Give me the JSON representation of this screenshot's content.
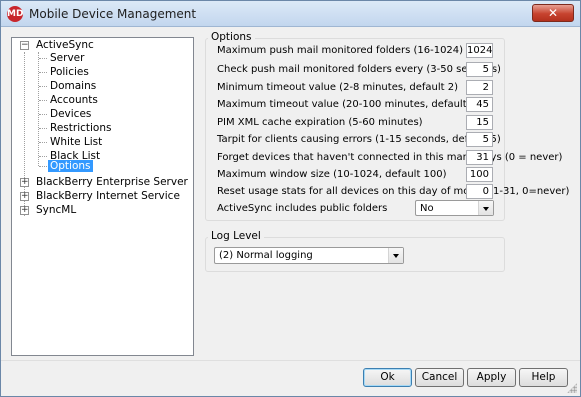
{
  "window": {
    "title": "Mobile Device Management",
    "app_icon": "MD",
    "close_glyph": "✕"
  },
  "tree": {
    "activesync": {
      "label": "ActiveSync",
      "expander": "−",
      "children": [
        "Server",
        "Policies",
        "Domains",
        "Accounts",
        "Devices",
        "Restrictions",
        "White List",
        "Black List",
        "Options"
      ],
      "selected": "Options"
    },
    "others": [
      {
        "label": "BlackBerry Enterprise Server",
        "expander": "+"
      },
      {
        "label": "BlackBerry Internet Service",
        "expander": "+"
      },
      {
        "label": "SyncML",
        "expander": "+"
      }
    ]
  },
  "options": {
    "title": "Options",
    "rows": [
      {
        "label": "Maximum push mail monitored folders (16-1024)",
        "value": "1024"
      },
      {
        "label": "Check push mail monitored folders every (3-50 seconds)",
        "value": "5"
      },
      {
        "label": "Minimum timeout value (2-8 minutes, default 2)",
        "value": "2"
      },
      {
        "label": "Maximum timeout value (20-100 minutes, default 45)",
        "value": "45"
      },
      {
        "label": "PIM XML cache expiration (5-60 minutes)",
        "value": "15"
      },
      {
        "label": "Tarpit for clients causing errors (1-15 seconds, default 5)",
        "value": "5"
      },
      {
        "label": "Forget devices that haven't connected in this many days (0 = never)",
        "value": "31"
      },
      {
        "label": "Maximum window size (10-1024, default 100)",
        "value": "100"
      },
      {
        "label": "Reset usage stats for all devices on this day of month (1-31, 0=never)",
        "value": "0"
      }
    ],
    "public_folders": {
      "label": "ActiveSync includes public folders",
      "value": "No"
    }
  },
  "log_level": {
    "title": "Log Level",
    "value": "(2) Normal logging"
  },
  "buttons": {
    "ok": "Ok",
    "cancel": "Cancel",
    "apply": "Apply",
    "help": "Help"
  }
}
